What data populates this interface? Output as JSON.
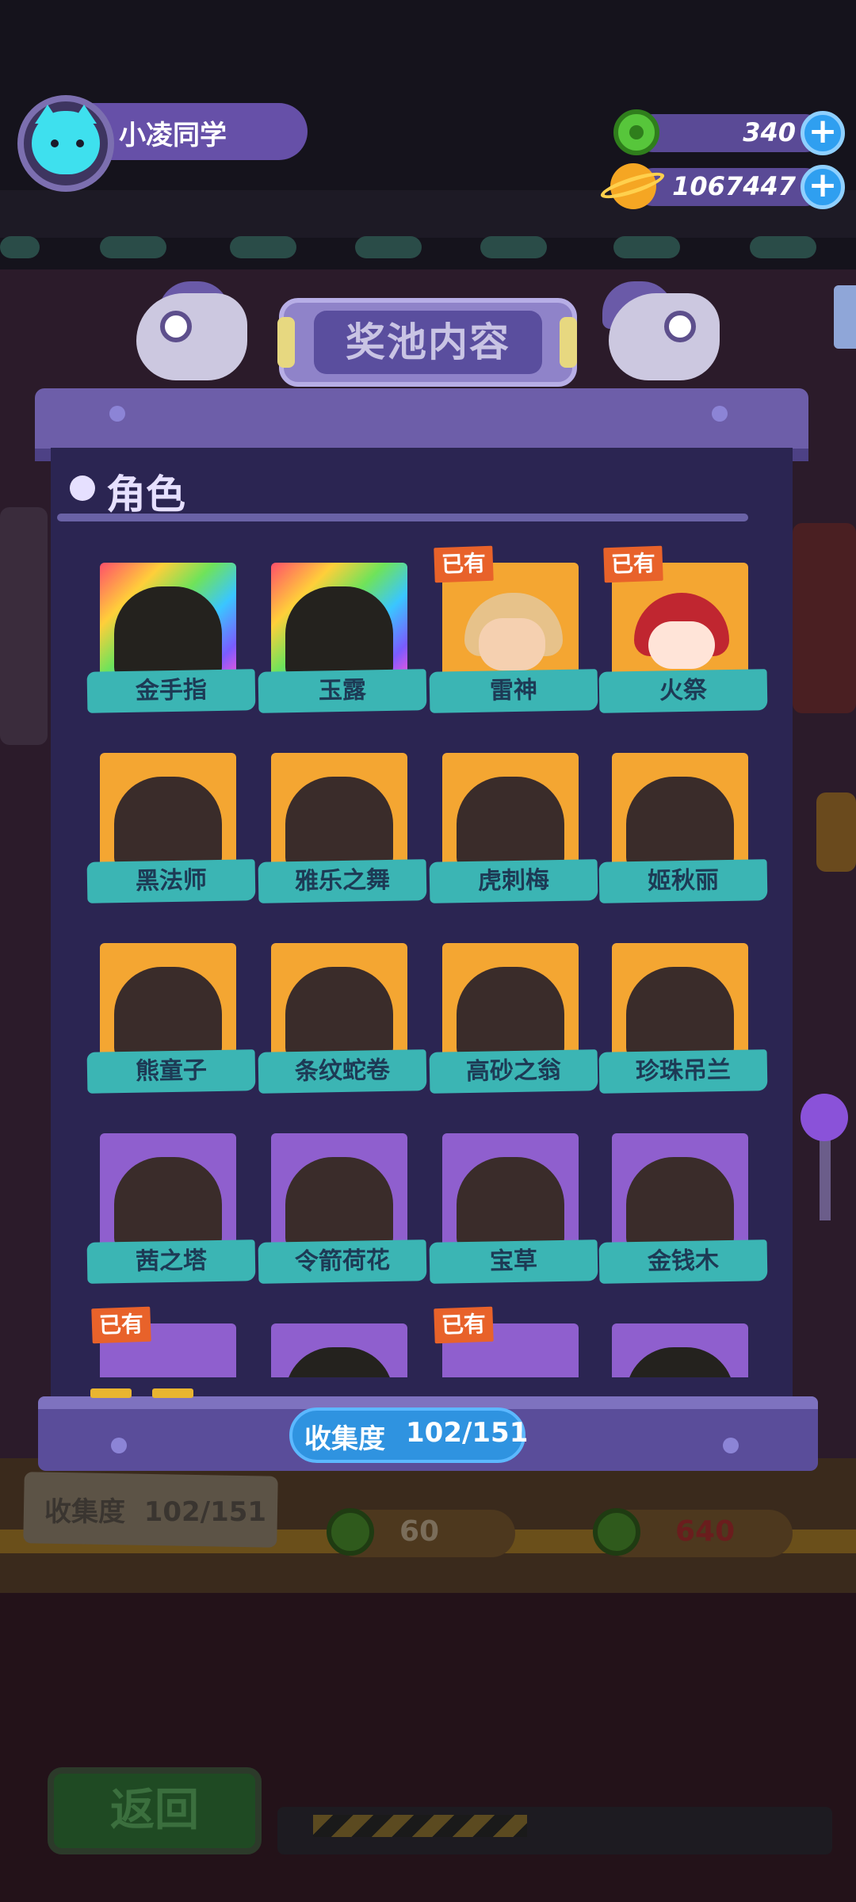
{
  "player": {
    "name": "小凌同学",
    "avatar_icon": "cyan-cat-icon"
  },
  "resources": [
    {
      "icon": "green-donut-icon",
      "value": "340"
    },
    {
      "icon": "orange-planet-icon",
      "value": "1067447"
    }
  ],
  "modal": {
    "title": "奖池内容",
    "section_title": "角色",
    "owned_tag": "已有",
    "characters": [
      {
        "name": "金手指",
        "card": "rainbow",
        "owned": false
      },
      {
        "name": "玉露",
        "card": "rainbow",
        "owned": false
      },
      {
        "name": "雷神",
        "card": "gold",
        "owned": true
      },
      {
        "name": "火祭",
        "card": "gold",
        "owned": true
      },
      {
        "name": "黑法师",
        "card": "gold",
        "owned": false
      },
      {
        "name": "雅乐之舞",
        "card": "gold",
        "owned": false
      },
      {
        "name": "虎刺梅",
        "card": "gold",
        "owned": false
      },
      {
        "name": "姬秋丽",
        "card": "gold",
        "owned": false
      },
      {
        "name": "熊童子",
        "card": "gold",
        "owned": false
      },
      {
        "name": "条纹蛇卷",
        "card": "gold",
        "owned": false
      },
      {
        "name": "高砂之翁",
        "card": "gold",
        "owned": false
      },
      {
        "name": "珍珠吊兰",
        "card": "gold",
        "owned": false
      },
      {
        "name": "茜之塔",
        "card": "purple",
        "owned": false
      },
      {
        "name": "令箭荷花",
        "card": "purple",
        "owned": false
      },
      {
        "name": "宝草",
        "card": "purple",
        "owned": false
      },
      {
        "name": "金钱木",
        "card": "purple",
        "owned": false
      },
      {
        "name": "",
        "card": "purple",
        "owned": true
      },
      {
        "name": "",
        "card": "purple",
        "owned": false
      },
      {
        "name": "",
        "card": "purple",
        "owned": true
      },
      {
        "name": "",
        "card": "purple",
        "owned": false
      }
    ],
    "collection": {
      "label": "收集度",
      "value": "102/151"
    }
  },
  "background": {
    "collection_label": "收集度",
    "collection_value": "102/151",
    "prices": [
      "60",
      "640"
    ],
    "back_button": "返回"
  },
  "colors": {
    "gold_card": "#f4a632",
    "purple_card": "#8f5fce",
    "ribbon": "#3bb5b4",
    "owned_tag": "#e8622a",
    "progress_pill": "#2f93e0"
  }
}
